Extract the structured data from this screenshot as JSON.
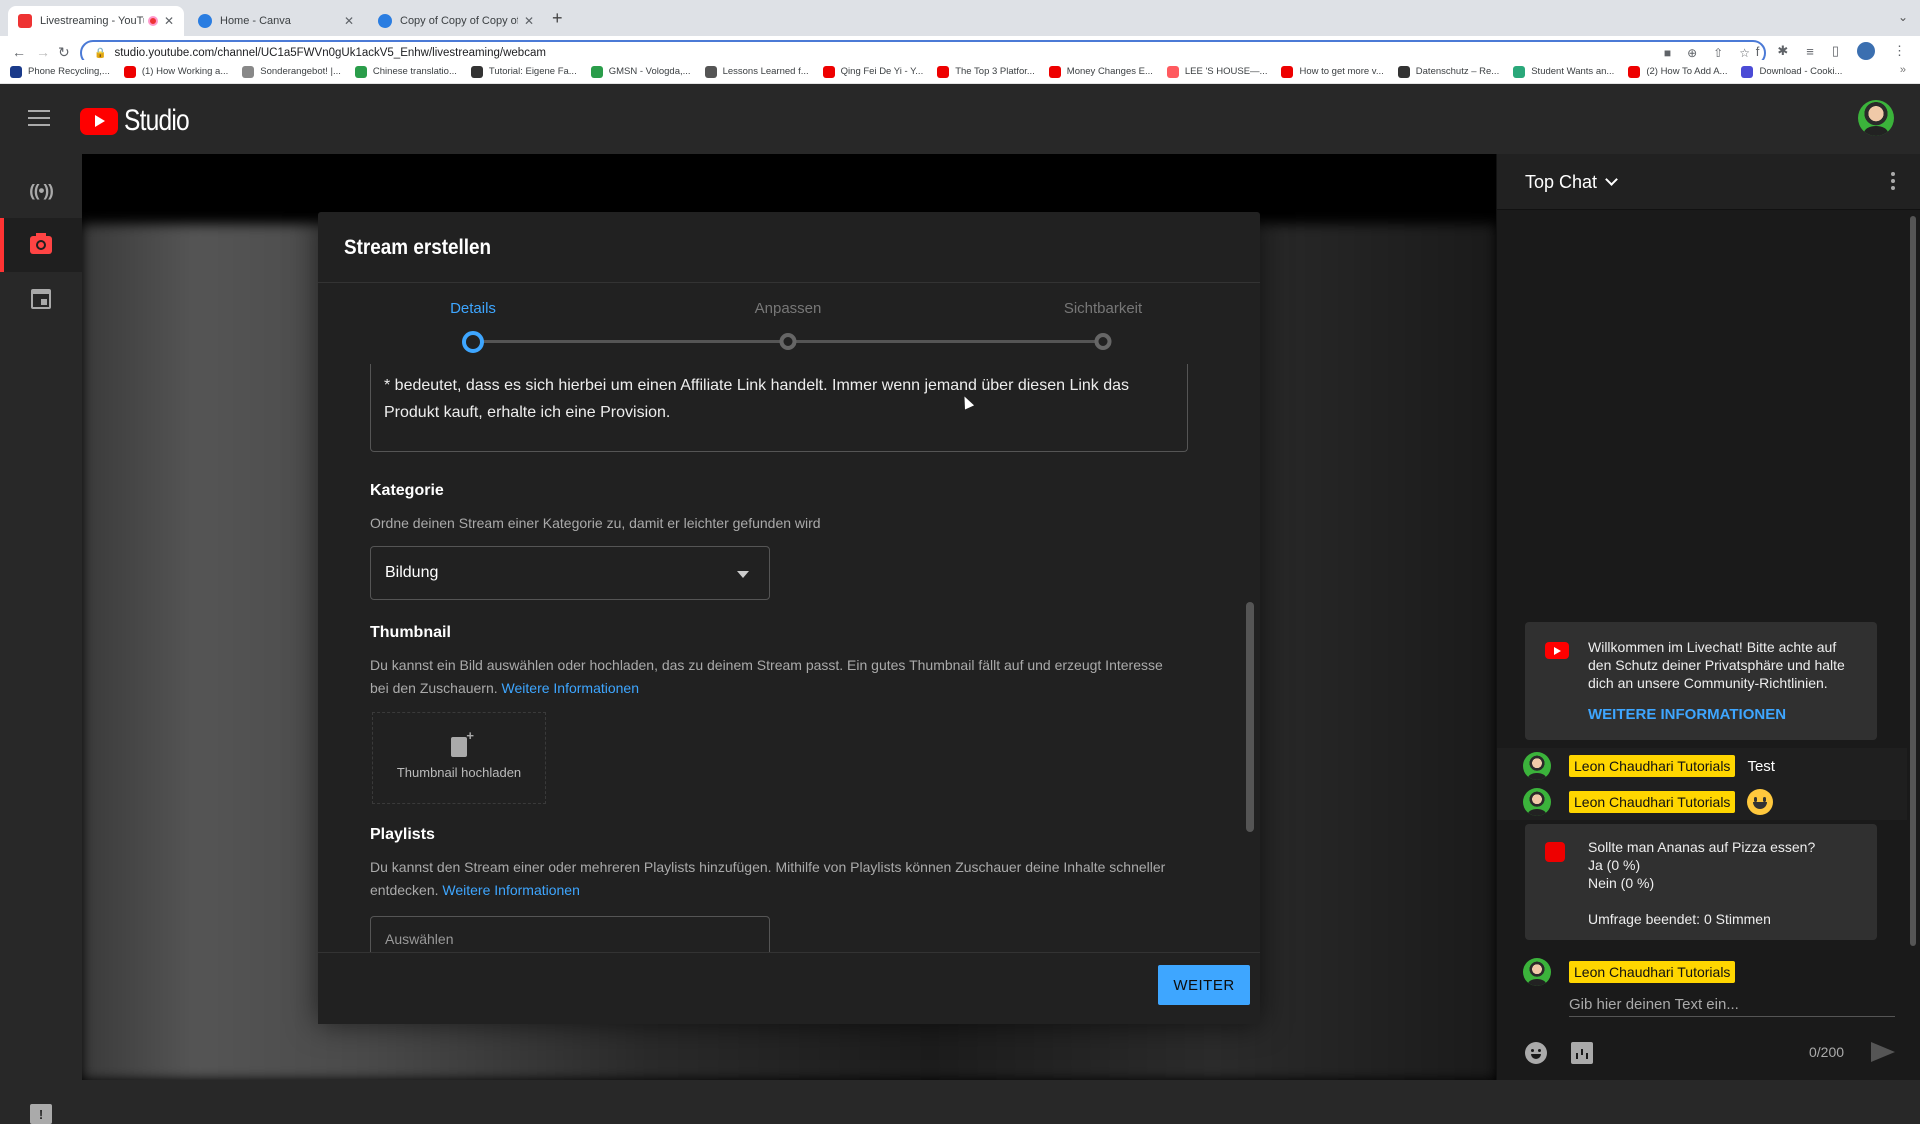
{
  "browser": {
    "tabs": [
      {
        "title": "Livestreaming - YouTube Studio",
        "active": true,
        "recording": true,
        "favicon_color": "#e33"
      },
      {
        "title": "Home - Canva",
        "active": false,
        "favicon_color": "#2a7de1"
      },
      {
        "title": "Copy of Copy of Copy of Copy",
        "active": false,
        "favicon_color": "#2a7de1"
      }
    ],
    "url": "studio.youtube.com/channel/UC1a5FWVn0gUk1ackV5_Enhw/livestreaming/webcam",
    "bookmarks": [
      {
        "label": "Phone Recycling,...",
        "icon": "o2-icon",
        "color": "#1a3a8a"
      },
      {
        "label": "(1) How Working a...",
        "icon": "youtube-icon",
        "color": "#e00"
      },
      {
        "label": "Sonderangebot! |...",
        "icon": "clock-icon",
        "color": "#888"
      },
      {
        "label": "Chinese translatio...",
        "icon": "upwork-icon",
        "color": "#2a9d4a"
      },
      {
        "label": "Tutorial: Eigene Fa...",
        "icon": "hash-icon",
        "color": "#333"
      },
      {
        "label": "GMSN - Vologda,...",
        "icon": "upwork-icon",
        "color": "#2a9d4a"
      },
      {
        "label": "Lessons Learned f...",
        "icon": "eir-icon",
        "color": "#555"
      },
      {
        "label": "Qing Fei De Yi - Y...",
        "icon": "youtube-icon",
        "color": "#e00"
      },
      {
        "label": "The Top 3 Platfor...",
        "icon": "youtube-icon",
        "color": "#e00"
      },
      {
        "label": "Money Changes E...",
        "icon": "youtube-icon",
        "color": "#e00"
      },
      {
        "label": "LEE 'S HOUSE—...",
        "icon": "airbnb-icon",
        "color": "#ff5a5f"
      },
      {
        "label": "How to get more v...",
        "icon": "youtube-icon",
        "color": "#e00"
      },
      {
        "label": "Datenschutz – Re...",
        "icon": "document-icon",
        "color": "#333"
      },
      {
        "label": "Student Wants an...",
        "icon": "t-icon",
        "color": "#2aa87a"
      },
      {
        "label": "(2) How To Add A...",
        "icon": "youtube-icon",
        "color": "#e00"
      },
      {
        "label": "Download - Cooki...",
        "icon": "circle-icon",
        "color": "#4b4bd6"
      }
    ],
    "more_label": "»"
  },
  "app": {
    "logo_text": "Studio",
    "brand_color": "#ff0000",
    "accent_color": "#3ea6ff"
  },
  "dialog": {
    "title": "Stream erstellen",
    "steps": [
      {
        "label": "Details",
        "active": true
      },
      {
        "label": "Anpassen",
        "active": false
      },
      {
        "label": "Sichtbarkeit",
        "active": false
      }
    ],
    "description_text": "* bedeutet, dass es sich hierbei um einen Affiliate Link handelt. Immer wenn jemand über diesen Link das Produkt kauft, erhalte ich eine Provision.",
    "category": {
      "title": "Kategorie",
      "subtitle": "Ordne deinen Stream einer Kategorie zu, damit er leichter gefunden wird",
      "selected": "Bildung"
    },
    "thumbnail": {
      "title": "Thumbnail",
      "subtitle": "Du kannst ein Bild auswählen oder hochladen, das zu deinem Stream passt. Ein gutes Thumbnail fällt auf und erzeugt Interesse bei den Zuschauern.",
      "link": "Weitere Informationen",
      "upload_label": "Thumbnail hochladen"
    },
    "playlists": {
      "title": "Playlists",
      "subtitle": "Du kannst den Stream einer oder mehreren Playlists hinzufügen. Mithilfe von Playlists können Zuschauer deine Inhalte schneller entdecken.",
      "link": "Weitere Informationen",
      "select_placeholder": "Auswählen"
    },
    "next_button": "WEITER"
  },
  "chat": {
    "title": "Top Chat",
    "welcome": {
      "text": "Willkommen im Livechat! Bitte achte auf den Schutz deiner Privatsphäre und halte dich an unsere Community-Richtlinien.",
      "link": "WEITERE INFORMATIONEN"
    },
    "messages": [
      {
        "author": "Leon Chaudhari Tutorials",
        "text": "Test"
      },
      {
        "author": "Leon Chaudhari Tutorials",
        "text": "",
        "emoji": "smiling-face"
      }
    ],
    "poll": {
      "question": "Sollte man Ananas auf Pizza essen?",
      "options": [
        "Ja (0 %)",
        "Nein (0 %)"
      ],
      "status": "Umfrage beendet: 0 Stimmen"
    },
    "composer": {
      "author": "Leon Chaudhari Tutorials",
      "placeholder": "Gib hier deinen Text ein...",
      "counter": "0/200"
    },
    "badge_color": "#ffd600"
  }
}
